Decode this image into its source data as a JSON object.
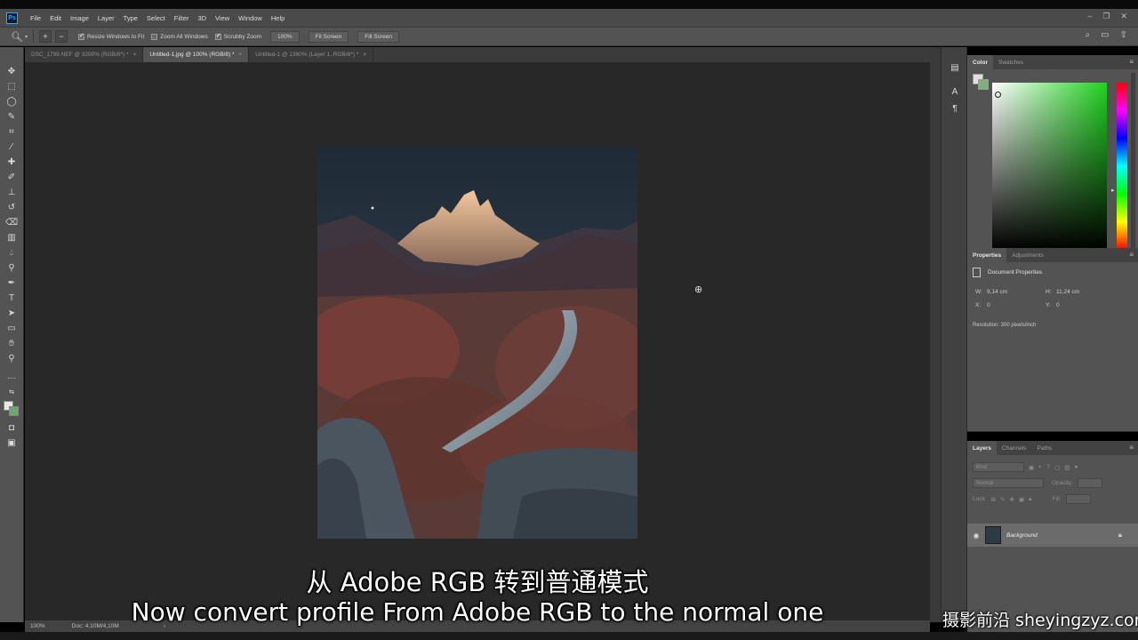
{
  "app": {
    "logo": "Ps"
  },
  "menu": [
    "File",
    "Edit",
    "Image",
    "Layer",
    "Type",
    "Select",
    "Filter",
    "3D",
    "View",
    "Window",
    "Help"
  ],
  "options_bar": {
    "resize_windows": "Resize Windows to Fit",
    "zoom_all": "Zoom All Windows",
    "scrubby_zoom": "Scrubby Zoom",
    "zoom_value": "100%",
    "fit_screen": "Fit Screen",
    "fill_screen": "Fill Screen"
  },
  "tabs": [
    {
      "label": "DSC_1799.NEF @ 3200% (RGB/8*) *",
      "close": "×"
    },
    {
      "label": "Untitled-1.jpg @ 100% (RGB/8) *",
      "close": "×"
    },
    {
      "label": "Untitled-1 @ 1360% (Layer 1, RGB/8*) *",
      "close": "×"
    }
  ],
  "color_panel": {
    "tab_color": "Color",
    "tab_swatches": "Swatches",
    "fg_color": "#e0e0e0",
    "bg_color": "#7bb27b",
    "picker_hue": "#1fd21f"
  },
  "properties_panel": {
    "tab_properties": "Properties",
    "tab_adjustments": "Adjustments",
    "title": "Document Properties",
    "w_label": "W:",
    "w_value": "9,14 cm",
    "h_label": "H:",
    "h_value": "11,24 cm",
    "x_label": "X:",
    "x_value": "0",
    "y_label": "Y:",
    "y_value": "0",
    "resolution": "Resolution: 300 pixels/inch"
  },
  "layers_panel": {
    "tab_layers": "Layers",
    "tab_channels": "Channels",
    "tab_paths": "Paths",
    "kind_label": "Kind",
    "blend_mode": "Normal",
    "opacity_label": "Opacity:",
    "lock_label": "Lock:",
    "fill_label": "Fill:",
    "layer_name": "Background"
  },
  "status_bar": {
    "zoom": "100%",
    "doc": "Doc: 4,10M/4,10M"
  },
  "subtitles": {
    "chinese": "从 Adobe RGB 转到普通模式",
    "english": "Now convert profile From Adobe RGB to the normal one"
  },
  "watermark": "摄影前沿 sheyingzyz.com"
}
